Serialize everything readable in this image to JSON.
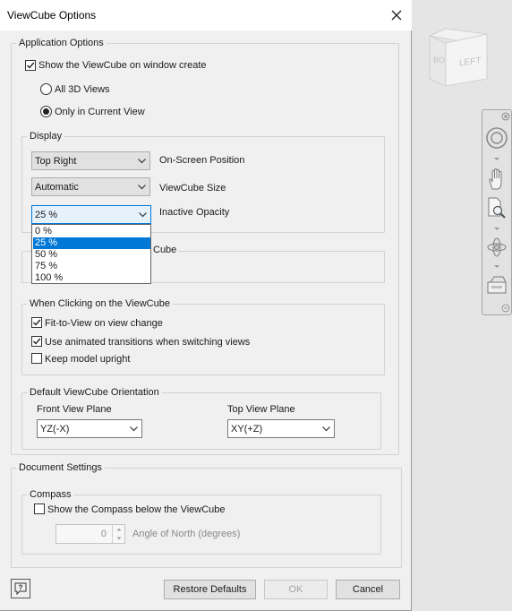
{
  "window": {
    "title": "ViewCube Options"
  },
  "app_options": {
    "legend": "Application Options",
    "show_on_create": {
      "label": "Show the ViewCube on window create",
      "checked": true
    },
    "radio_all_3d": {
      "label": "All 3D Views",
      "selected": false
    },
    "radio_current": {
      "label": "Only in Current View",
      "selected": true
    }
  },
  "display": {
    "legend": "Display",
    "position": {
      "value": "Top Right",
      "label": "On-Screen Position"
    },
    "size": {
      "value": "Automatic",
      "label": "ViewCube Size"
    },
    "opacity": {
      "value": "25 %",
      "label": "Inactive Opacity",
      "options": [
        "0 %",
        "25 %",
        "50 %",
        "75 %",
        "100 %"
      ],
      "highlighted": "25 %"
    }
  },
  "hidden_group": {
    "legend_fragment": "Cube"
  },
  "clicking": {
    "legend": "When Clicking on the ViewCube",
    "fit_to_view": {
      "label": "Fit-to-View on view change",
      "checked": true
    },
    "animated": {
      "label": "Use animated transitions when switching views",
      "checked": true
    },
    "upright": {
      "label": "Keep model upright",
      "checked": false
    }
  },
  "orientation": {
    "legend": "Default ViewCube Orientation",
    "front": {
      "label": "Front View Plane",
      "value": "YZ(-X)"
    },
    "top": {
      "label": "Top View Plane",
      "value": "XY(+Z)"
    }
  },
  "document": {
    "legend": "Document Settings",
    "compass": {
      "legend": "Compass",
      "show": {
        "label": "Show the Compass below the ViewCube",
        "checked": false
      },
      "angle": {
        "value": "0",
        "label": "Angle of North (degrees)"
      }
    }
  },
  "buttons": {
    "restore": "Restore Defaults",
    "ok": "OK",
    "cancel": "Cancel"
  },
  "viewcube": {
    "face_left": "LEFT",
    "face_front": "BO"
  },
  "colors": {
    "accent": "#0078d7",
    "dialog_bg": "#f0f0f0",
    "viewport_bg": "#e5e5e5"
  }
}
